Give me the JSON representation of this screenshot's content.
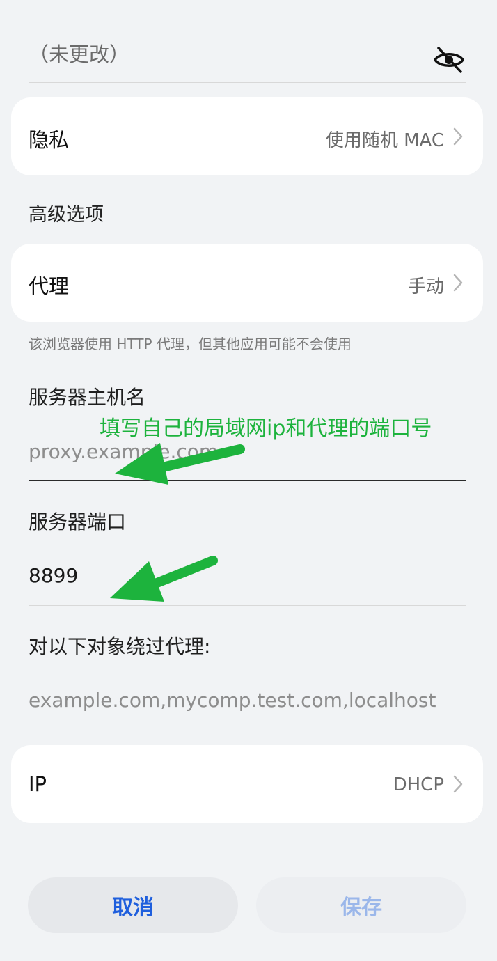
{
  "password": {
    "value": "（未更改）",
    "toggle_icon": "eye-off-icon"
  },
  "privacy": {
    "label": "隐私",
    "value": "使用随机 MAC"
  },
  "advanced": {
    "title": "高级选项"
  },
  "proxy": {
    "label": "代理",
    "value": "手动",
    "hint": "该浏览器使用 HTTP 代理，但其他应用可能不会使用"
  },
  "hostname": {
    "label": "服务器主机名",
    "placeholder": "proxy.example.com"
  },
  "annotation": {
    "text": "填写自己的局域网ip和代理的端口号",
    "color": "#1db33d"
  },
  "port": {
    "label": "服务器端口",
    "value": "8899"
  },
  "bypass": {
    "label": "对以下对象绕过代理:",
    "placeholder": "example.com,mycomp.test.com,localhost"
  },
  "ip": {
    "label": "IP",
    "value": "DHCP"
  },
  "buttons": {
    "cancel": "取消",
    "save": "保存"
  },
  "colors": {
    "background": "#f1f3f5",
    "accent": "#1f5fdd",
    "arrow": "#1db33d"
  }
}
